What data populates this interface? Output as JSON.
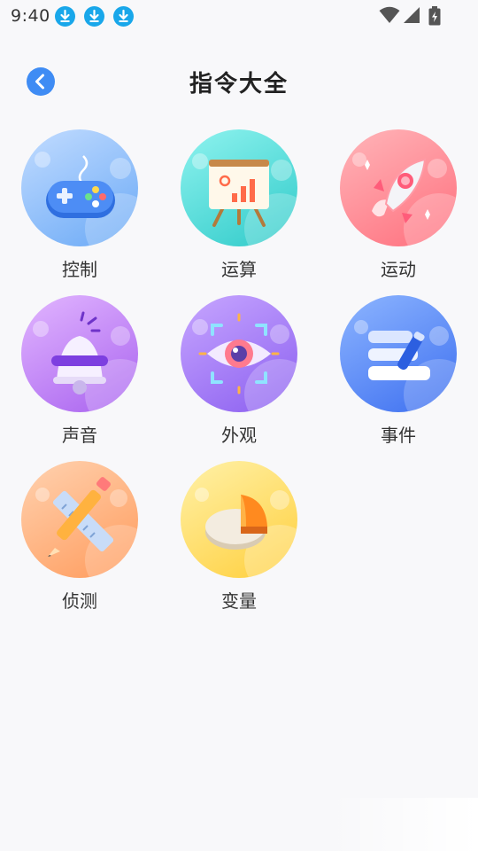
{
  "status_bar": {
    "time": "9:40",
    "notification_icons": [
      "download-icon",
      "download-icon",
      "download-icon"
    ],
    "system_icons": [
      "wifi-icon",
      "signal-icon",
      "battery-charging-icon"
    ],
    "accent_color": "#19a7ea"
  },
  "header": {
    "title": "指令大全",
    "back_icon": "chevron-left-icon",
    "back_color": "#3f8cf4"
  },
  "categories": [
    {
      "label": "控制",
      "icon": "gamepad-icon",
      "color": "#7cb6f8"
    },
    {
      "label": "运算",
      "icon": "presentation-chart-icon",
      "color": "#4fdbd6"
    },
    {
      "label": "运动",
      "icon": "rocket-icon",
      "color": "#ff8a92"
    },
    {
      "label": "声音",
      "icon": "bell-icon",
      "color": "#c58af5"
    },
    {
      "label": "外观",
      "icon": "eye-icon",
      "color": "#a77ff3"
    },
    {
      "label": "事件",
      "icon": "pen-note-icon",
      "color": "#5f8df6"
    },
    {
      "label": "侦测",
      "icon": "ruler-pencil-icon",
      "color": "#ffb07a"
    },
    {
      "label": "变量",
      "icon": "pie-chart-icon",
      "color": "#ffd44f"
    }
  ]
}
